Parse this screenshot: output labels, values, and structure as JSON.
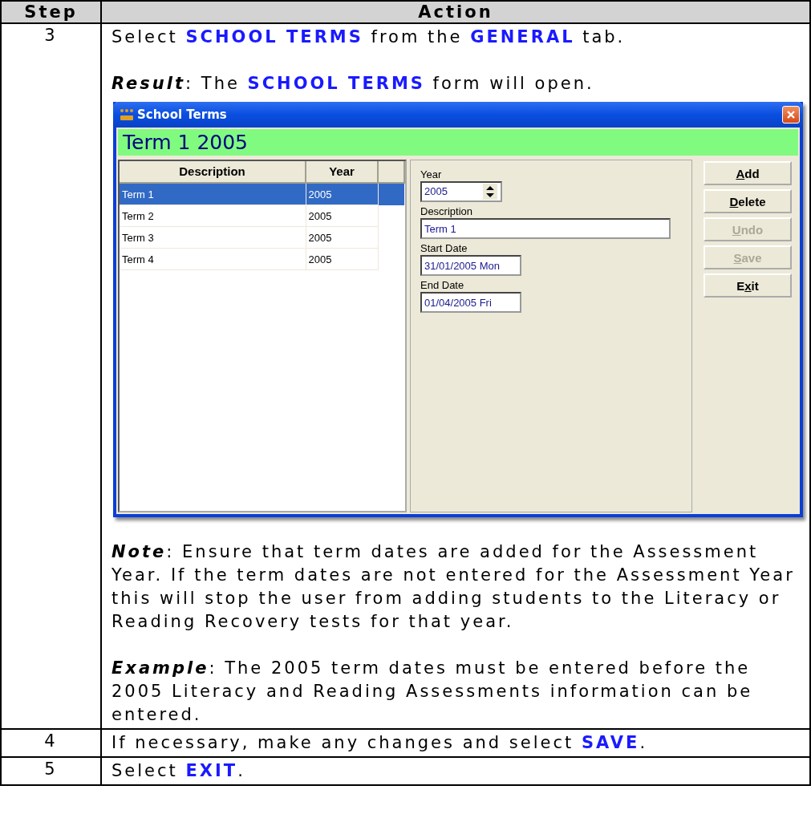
{
  "table": {
    "columns": [
      "Step",
      "Action"
    ],
    "rows": [
      {
        "step": "3",
        "blocks": [
          {
            "kind": "text",
            "text": "Select **SCHOOL TERMS** from the **GENERAL** tab."
          },
          {
            "kind": "text",
            "text": "*Result*: The **SCHOOL TERMS** form will open."
          },
          {
            "kind": "window",
            "window": {
              "title": "School Terms",
              "banner": "Term 1 2005",
              "list": {
                "columns": [
                  "Description",
                  "Year"
                ],
                "rows": [
                  {
                    "cells": [
                      "Term 1",
                      "2005"
                    ],
                    "selected": true
                  },
                  {
                    "cells": [
                      "Term 2",
                      "2005"
                    ],
                    "selected": false
                  },
                  {
                    "cells": [
                      "Term 3",
                      "2005"
                    ],
                    "selected": false
                  },
                  {
                    "cells": [
                      "Term 4",
                      "2005"
                    ],
                    "selected": false
                  }
                ]
              },
              "fields": [
                {
                  "kind": "spinner",
                  "label": "Year",
                  "value": "2005"
                },
                {
                  "kind": "wide",
                  "label": "Description",
                  "value": "Term 1"
                },
                {
                  "kind": "date",
                  "label": "Start Date",
                  "value": "31/01/2005 Mon"
                },
                {
                  "kind": "date",
                  "label": "End Date",
                  "value": "01/04/2005 Fri"
                }
              ],
              "buttons": [
                {
                  "hotkey": "A",
                  "rest": "dd",
                  "disabled": false
                },
                {
                  "hotkey": "D",
                  "rest": "elete",
                  "disabled": false
                },
                {
                  "hotkey": "U",
                  "rest": "ndo",
                  "disabled": true
                },
                {
                  "hotkey": "S",
                  "rest": "ave",
                  "disabled": true
                },
                {
                  "before": "E",
                  "hotkey": "x",
                  "rest": "it",
                  "disabled": false
                }
              ]
            }
          },
          {
            "kind": "text",
            "text": "*Note*:  Ensure that term dates are added for the Assessment Year.   If the term dates are not entered for the Assessment Year this will stop the user from adding students to the Literacy or Reading Recovery tests for that year."
          },
          {
            "kind": "text",
            "text": "*Example*: The 2005 term dates must be entered before the 2005 Literacy and Reading Assessments information can be entered."
          }
        ]
      },
      {
        "step": "4",
        "blocks": [
          {
            "kind": "text",
            "text": "If necessary, make any changes and select **SAVE**."
          }
        ]
      },
      {
        "step": "5",
        "blocks": [
          {
            "kind": "text",
            "text": "Select **EXIT**."
          }
        ]
      }
    ]
  }
}
